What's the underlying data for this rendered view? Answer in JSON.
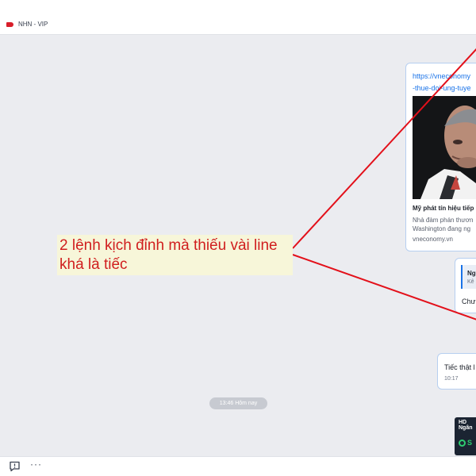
{
  "header": {
    "group_tag": "NHN - VIP",
    "tag_color": "#d81e2a"
  },
  "link_preview": {
    "url_line1": "https://vneconomy",
    "url_line2": "-thue-doi-ung-tuye",
    "title": "Mỹ phát tín hiệu tiếp",
    "desc_line1": "Nhà đàm phán thươn",
    "desc_line2": "Washington đang ng",
    "domain": "vneconomy.vn",
    "image_icon": "news-photo"
  },
  "reply_message": {
    "quote_title": "Ng",
    "quote_sub": "Kê",
    "text": "Chưa"
  },
  "message": {
    "text": "Tiếc thật l",
    "time": "10:17"
  },
  "time_separator": "13:46 Hôm nay",
  "shared_card": {
    "badge": "HD",
    "subtitle": "Ngân",
    "letter": "S"
  },
  "annotation": {
    "line1": "2 lệnh kịch đỉnh mà thiếu vài line",
    "line2": "khá là tiếc",
    "color": "#d01e1e"
  },
  "footer": {
    "feedback_icon": "feedback-icon",
    "more_label": "···"
  }
}
